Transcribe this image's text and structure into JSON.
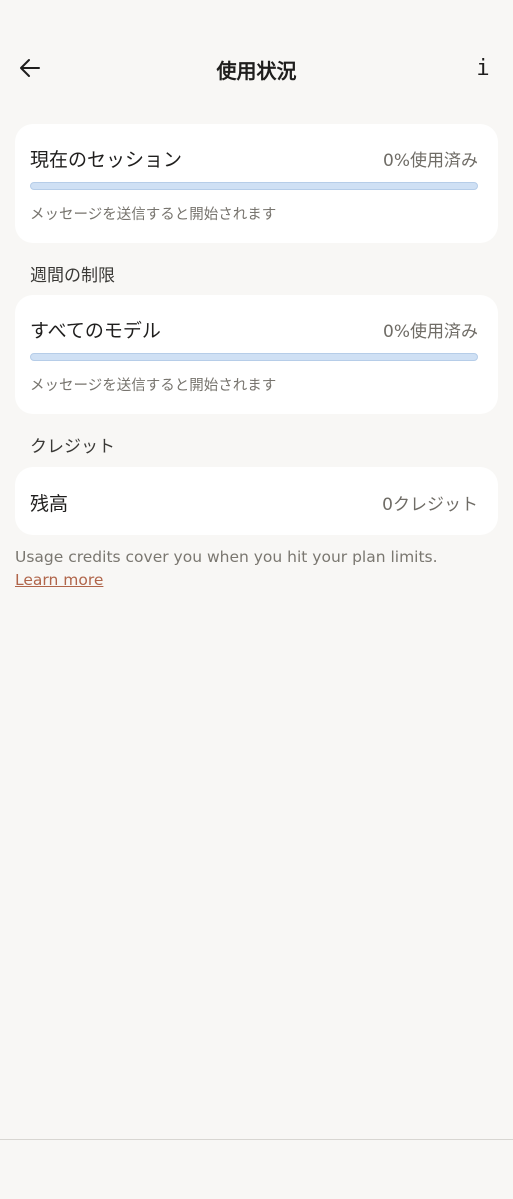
{
  "header": {
    "title": "使用状況",
    "back_icon": "arrow-left-icon",
    "info_label": "i"
  },
  "session": {
    "title": "現在のセッション",
    "usage": "0%使用済み",
    "progress_percent": 0,
    "subtitle": "メッセージを送信すると開始されます"
  },
  "weekly": {
    "section_label": "週間の制限",
    "title": "すべてのモデル",
    "usage": "0%使用済み",
    "progress_percent": 0,
    "subtitle": "メッセージを送信すると開始されます"
  },
  "credits": {
    "section_label": "クレジット",
    "title": "残高",
    "value": "0クレジット",
    "note": "Usage credits cover you when you hit your plan limits.",
    "learn_more": "Learn more"
  },
  "colors": {
    "background": "#f8f7f5",
    "card": "#ffffff",
    "progress_track": "#cfe0f4",
    "link": "#b0654a"
  }
}
